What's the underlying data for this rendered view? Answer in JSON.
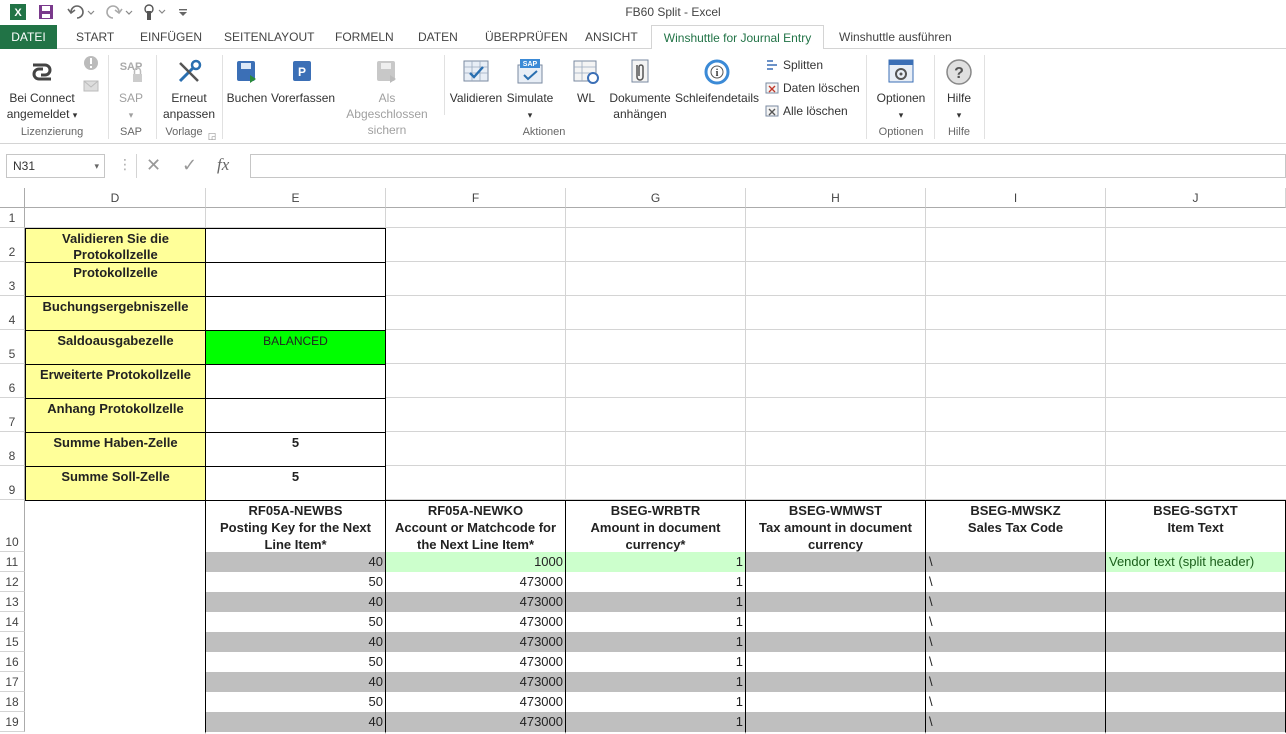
{
  "window": {
    "title": "FB60 Split - Excel",
    "quick_access": {
      "excel_icon": "excel-logo-icon",
      "save_icon": "save-icon",
      "undo_icon": "undo-icon",
      "redo_icon": "redo-icon",
      "touch_icon": "touch-mode-icon",
      "customize_icon": "customize-qat-icon"
    }
  },
  "tabs": [
    {
      "label": "DATEI"
    },
    {
      "label": "START"
    },
    {
      "label": "EINFÜGEN"
    },
    {
      "label": "SEITENLAYOUT"
    },
    {
      "label": "FORMELN"
    },
    {
      "label": "DATEN"
    },
    {
      "label": "ÜBERPRÜFEN"
    },
    {
      "label": "ANSICHT"
    },
    {
      "label": "Winshuttle for Journal Entry"
    },
    {
      "label": "Winshuttle ausführen"
    }
  ],
  "ribbon": {
    "connect": {
      "line1": "Bei Connect",
      "line2": "angemeldet",
      "group": "Lizenzierung"
    },
    "sap": {
      "label": "SAP",
      "group": "SAP"
    },
    "erneut": {
      "line1": "Erneut",
      "line2": "anpassen",
      "group": "Vorlage"
    },
    "buchen": {
      "label": "Buchen"
    },
    "vorerfassen": {
      "label": "Vorerfassen"
    },
    "abgeschlossen": {
      "line1": "Als Abgeschlossen",
      "line2": "sichern"
    },
    "validieren": {
      "label": "Validieren"
    },
    "simulate": {
      "label": "Simulate"
    },
    "wl": {
      "label": "WL"
    },
    "dokumente": {
      "line1": "Dokumente",
      "line2": "anhängen"
    },
    "schleifen": {
      "label": "Schleifendetails"
    },
    "splitten": {
      "label": "Splitten"
    },
    "daten_loeschen": {
      "label": "Daten löschen"
    },
    "alle_loeschen": {
      "label": "Alle löschen"
    },
    "aktionen_group": "Aktionen",
    "optionen": {
      "label": "Optionen",
      "group": "Optionen"
    },
    "hilfe": {
      "label": "Hilfe",
      "group": "Hilfe"
    }
  },
  "formula_bar": {
    "name_box": "N31",
    "cancel_glyph": "✕",
    "enter_glyph": "✓",
    "fx_glyph": "fx",
    "content": ""
  },
  "columns": [
    "D",
    "E",
    "F",
    "G",
    "H",
    "I",
    "J"
  ],
  "rows": [
    "1",
    "2",
    "3",
    "4",
    "5",
    "6",
    "7",
    "8",
    "9",
    "10",
    "11",
    "12",
    "13",
    "14",
    "15",
    "16",
    "17",
    "18",
    "19"
  ],
  "info_block": [
    {
      "label": "Validieren Sie die Protokollzelle",
      "value": ""
    },
    {
      "label": "Protokollzelle",
      "value": ""
    },
    {
      "label": "Buchungsergebniszelle",
      "value": ""
    },
    {
      "label": "Saldoausgabezelle",
      "value": "BALANCED"
    },
    {
      "label": "Erweiterte Protokollzelle",
      "value": ""
    },
    {
      "label": "Anhang Protokollzelle",
      "value": ""
    },
    {
      "label": "Summe Haben-Zelle",
      "value": "5"
    },
    {
      "label": "Summe Soll-Zelle",
      "value": "5"
    }
  ],
  "table_headers": [
    {
      "code": "RF05A-NEWBS",
      "desc": "Posting Key for the Next Line Item*"
    },
    {
      "code": "RF05A-NEWKO",
      "desc": "Account or Matchcode for the Next Line Item*"
    },
    {
      "code": "BSEG-WRBTR",
      "desc": "Amount in document currency*"
    },
    {
      "code": "BSEG-WMWST",
      "desc": "Tax amount in document currency"
    },
    {
      "code": "BSEG-MWSKZ",
      "desc": "Sales Tax Code"
    },
    {
      "code": "BSEG-SGTXT",
      "desc": "Item Text"
    }
  ],
  "data_rows": [
    {
      "e": "40",
      "f": "1000",
      "g": "1",
      "h": "",
      "i": "\\",
      "j": "Vendor text (split header)"
    },
    {
      "e": "50",
      "f": "473000",
      "g": "1",
      "h": "",
      "i": "\\",
      "j": ""
    },
    {
      "e": "40",
      "f": "473000",
      "g": "1",
      "h": "",
      "i": "\\",
      "j": ""
    },
    {
      "e": "50",
      "f": "473000",
      "g": "1",
      "h": "",
      "i": "\\",
      "j": ""
    },
    {
      "e": "40",
      "f": "473000",
      "g": "1",
      "h": "",
      "i": "\\",
      "j": ""
    },
    {
      "e": "50",
      "f": "473000",
      "g": "1",
      "h": "",
      "i": "\\",
      "j": ""
    },
    {
      "e": "40",
      "f": "473000",
      "g": "1",
      "h": "",
      "i": "\\",
      "j": ""
    },
    {
      "e": "50",
      "f": "473000",
      "g": "1",
      "h": "",
      "i": "\\",
      "j": ""
    },
    {
      "e": "40",
      "f": "473000",
      "g": "1",
      "h": "",
      "i": "\\",
      "j": ""
    }
  ],
  "colors": {
    "excel_green": "#217346",
    "label_yellow": "#ffff99",
    "balanced_green": "#00ff00",
    "row_gray": "#bfbfbf",
    "header_row_green": "#ccffcc"
  }
}
